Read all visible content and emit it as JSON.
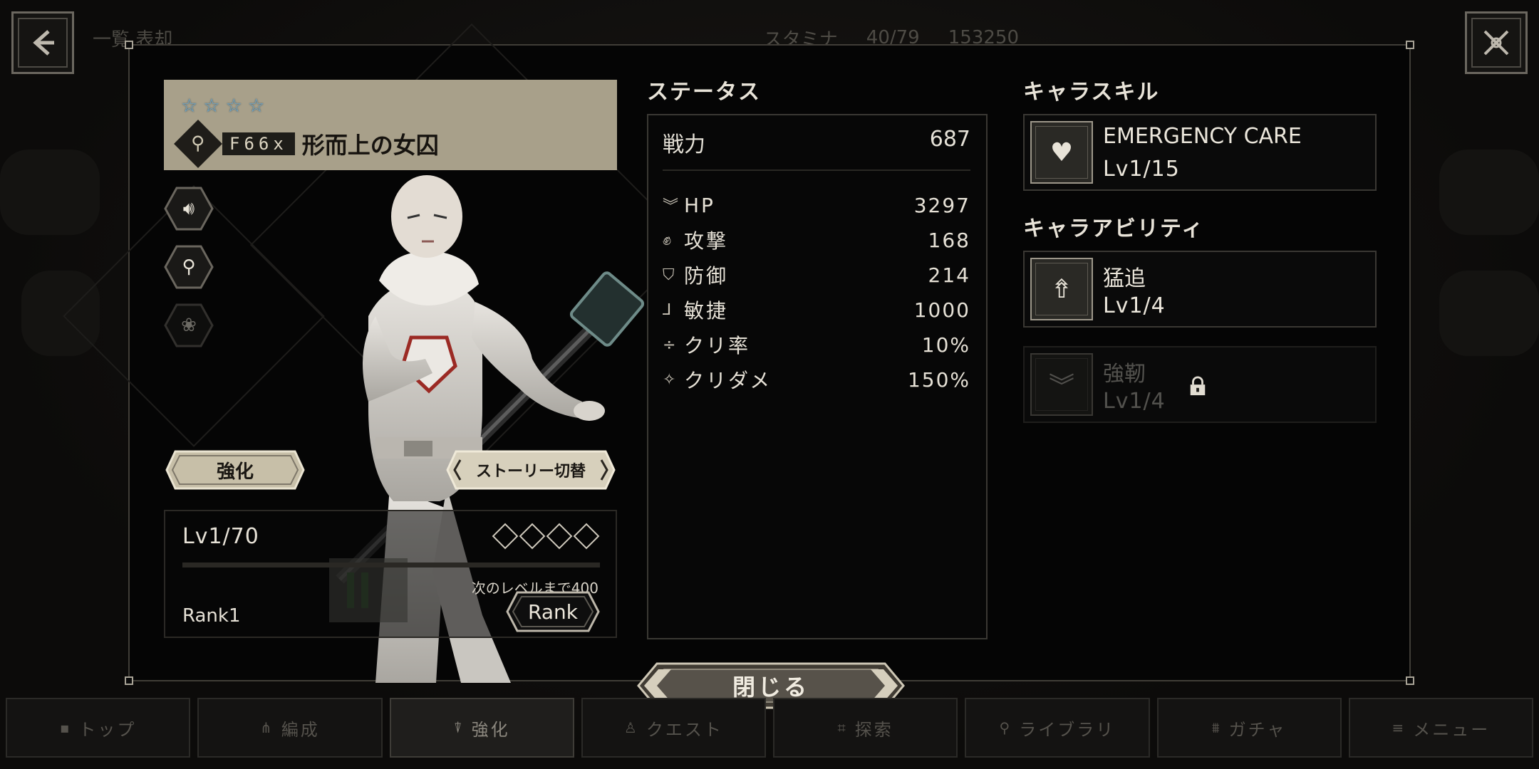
{
  "header": {
    "title_partial": "一覧  表却",
    "stamina_label": "スタミナ",
    "stamina_value": "40/79",
    "currency_value": "153250"
  },
  "character": {
    "stars": 4,
    "code": "F66x",
    "name": "形而上の女囚",
    "enhance_label": "強化",
    "story_switch_label": "ストーリー切替",
    "level": "Lv1/70",
    "exp_fraction": 0.0,
    "next_level_text": "次のレベルまで400",
    "rank": "Rank1",
    "rank_button_label": "Rank"
  },
  "status": {
    "title": "ステータス",
    "power_label": "戦力",
    "power_value": "687",
    "stats": [
      {
        "icon": "chevron-down-icon",
        "label": "HP",
        "value": "3297"
      },
      {
        "icon": "fist-icon",
        "label": "攻撃",
        "value": "168"
      },
      {
        "icon": "shield-icon",
        "label": "防御",
        "value": "214"
      },
      {
        "icon": "boot-icon",
        "label": "敏捷",
        "value": "1000"
      },
      {
        "icon": "divide-icon",
        "label": "クリ率",
        "value": "10%"
      },
      {
        "icon": "sparkle-icon",
        "label": "クリダメ",
        "value": "150%"
      }
    ]
  },
  "skills": {
    "skill_title": "キャラスキル",
    "skill": {
      "name": "EMERGENCY CARE",
      "level": "Lv1/15",
      "icon": "heart-arrows-icon"
    },
    "ability_title": "キャラアビリティ",
    "abilities": [
      {
        "name": "猛追",
        "level": "Lv1/4",
        "icon": "flame-arrow-icon",
        "locked": false
      },
      {
        "name": "強靭",
        "level": "Lv1/4",
        "icon": "double-chevron-icon",
        "locked": true
      }
    ]
  },
  "close_label": "閉じる",
  "nav": [
    {
      "label": "トップ",
      "icon": "home-icon",
      "active": false
    },
    {
      "label": "編成",
      "icon": "formation-icon",
      "active": false
    },
    {
      "label": "強化",
      "icon": "enhance-icon",
      "active": true
    },
    {
      "label": "クエスト",
      "icon": "quest-icon",
      "active": false
    },
    {
      "label": "探索",
      "icon": "explore-icon",
      "active": false
    },
    {
      "label": "ライブラリ",
      "icon": "library-icon",
      "active": false
    },
    {
      "label": "ガチャ",
      "icon": "gacha-icon",
      "active": false
    },
    {
      "label": "メニュー",
      "icon": "menu-icon",
      "active": false
    }
  ],
  "colors": {
    "accent_plate": "#a8a08a",
    "star_blue": "#6fa7c9",
    "panel_border": "#3a3833"
  }
}
